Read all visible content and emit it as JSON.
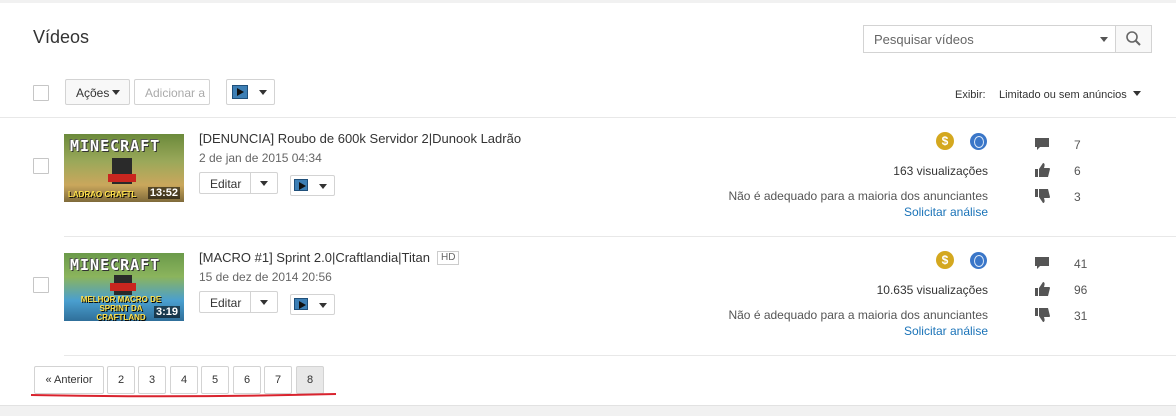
{
  "header": {
    "title": "Vídeos"
  },
  "search": {
    "placeholder": "Pesquisar vídeos"
  },
  "toolbar": {
    "actions_label": "Ações",
    "add_to_label": "Adicionar a",
    "show_label": "Exibir:",
    "show_value": "Limitado ou sem anúncios"
  },
  "videos": [
    {
      "title": "[DENUNCIA] Roubo de 600k Servidor 2|Dunook Ladrão",
      "date": "2 de jan de 2015 04:34",
      "duration": "13:52",
      "thumb_title": "MINECRAFT",
      "thumb_caption": "LADRAO CRAFTL",
      "edit_label": "Editar",
      "views": "163 visualizações",
      "monetization": "Não é adequado para a maioria dos anunciantes",
      "request_review": "Solicitar análise",
      "comments": "7",
      "likes": "6",
      "dislikes": "3",
      "hd": ""
    },
    {
      "title": "[MACRO #1] Sprint 2.0|Craftlandia|Titan",
      "date": "15 de dez de 2014 20:56",
      "duration": "3:19",
      "thumb_title": "MINECRAFT",
      "thumb_caption": "MELHOR MACRO DE SPRINT DA CRAFTLAND",
      "edit_label": "Editar",
      "views": "10.635 visualizações",
      "monetization": "Não é adequado para a maioria dos anunciantes",
      "request_review": "Solicitar análise",
      "comments": "41",
      "likes": "96",
      "dislikes": "31",
      "hd": "HD"
    }
  ],
  "pagination": {
    "prev_label": "« Anterior",
    "pages": [
      "2",
      "3",
      "4",
      "5",
      "6",
      "7",
      "8"
    ],
    "current": "8"
  },
  "colors": {
    "monetization_coin": "#d4a81f",
    "public_globe": "#3a76c8",
    "link": "#1a73b8",
    "annotation_underline": "#d9232e"
  },
  "icons": [
    "search-icon",
    "dollar-coin-icon",
    "globe-icon",
    "comment-icon",
    "thumbs-up-icon",
    "thumbs-down-icon",
    "playlist-icon"
  ]
}
